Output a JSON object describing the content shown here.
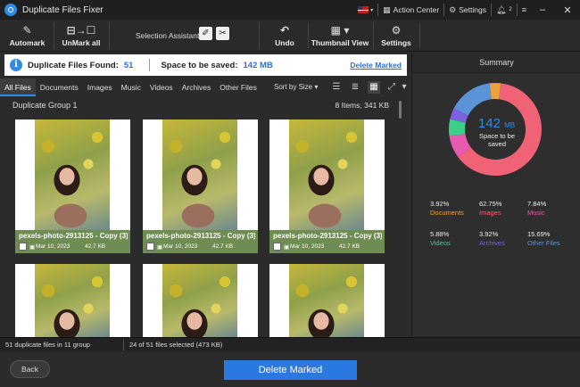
{
  "window": {
    "title": "Duplicate Files Fixer"
  },
  "titlebar": {
    "action_center": "Action Center",
    "settings": "Settings",
    "notif_count": "2"
  },
  "toolbar": {
    "automark": "Automark",
    "unmark_all": "UnMark all",
    "selection_assistant": "Selection Assistant",
    "undo": "Undo",
    "thumbnail_view": "Thumbnail View",
    "settings": "Settings"
  },
  "infobar": {
    "found_label": "Duplicate Files Found:",
    "found_value": "51",
    "space_label": "Space to be saved:",
    "space_value": "142 MB",
    "delete_link": "Delete Marked"
  },
  "tabs": [
    "All Files",
    "Documents",
    "Images",
    "Music",
    "Videos",
    "Archives",
    "Other Files"
  ],
  "sort_by": "Sort by Size",
  "group": {
    "title": "Duplicate Group 1",
    "count": "8 Items, 341 KB"
  },
  "cards": [
    {
      "name": "pexels-photo-2913125 - Copy (3)...",
      "date": "Mar 10, 2023",
      "size": "42.7 KB"
    },
    {
      "name": "pexels-photo-2913125 - Copy (3)...",
      "date": "Mar 10, 2023",
      "size": "42.7 KB"
    },
    {
      "name": "pexels-photo-2913125 - Copy (3)...",
      "date": "Mar 10, 2023",
      "size": "42.7 KB"
    },
    {
      "name": "",
      "date": "",
      "size": ""
    },
    {
      "name": "",
      "date": "",
      "size": ""
    },
    {
      "name": "",
      "date": "",
      "size": ""
    }
  ],
  "summary": {
    "title": "Summary",
    "total_value": "142",
    "total_unit": "MB",
    "total_label": "Space to be saved",
    "stats": [
      {
        "pct": "3.92%",
        "label": "Documents",
        "color": "#e8a33a",
        "fraction": 0.0392
      },
      {
        "pct": "62.75%",
        "label": "Images",
        "color": "#f06275",
        "fraction": 0.6275
      },
      {
        "pct": "7.84%",
        "label": "Music",
        "color": "#e45bb0",
        "fraction": 0.0784
      },
      {
        "pct": "5.88%",
        "label": "Videos",
        "color": "#3ccf8a",
        "fraction": 0.0588
      },
      {
        "pct": "3.92%",
        "label": "Archives",
        "color": "#7b62e0",
        "fraction": 0.0392
      },
      {
        "pct": "15.69%",
        "label": "Other Files",
        "color": "#5b93d8",
        "fraction": 0.1569
      }
    ]
  },
  "statusbar": {
    "left": "51 duplicate files in 11 group",
    "right": "24 of 51 files selected  (473 KB)"
  },
  "bottom": {
    "back": "Back",
    "delete": "Delete Marked"
  }
}
